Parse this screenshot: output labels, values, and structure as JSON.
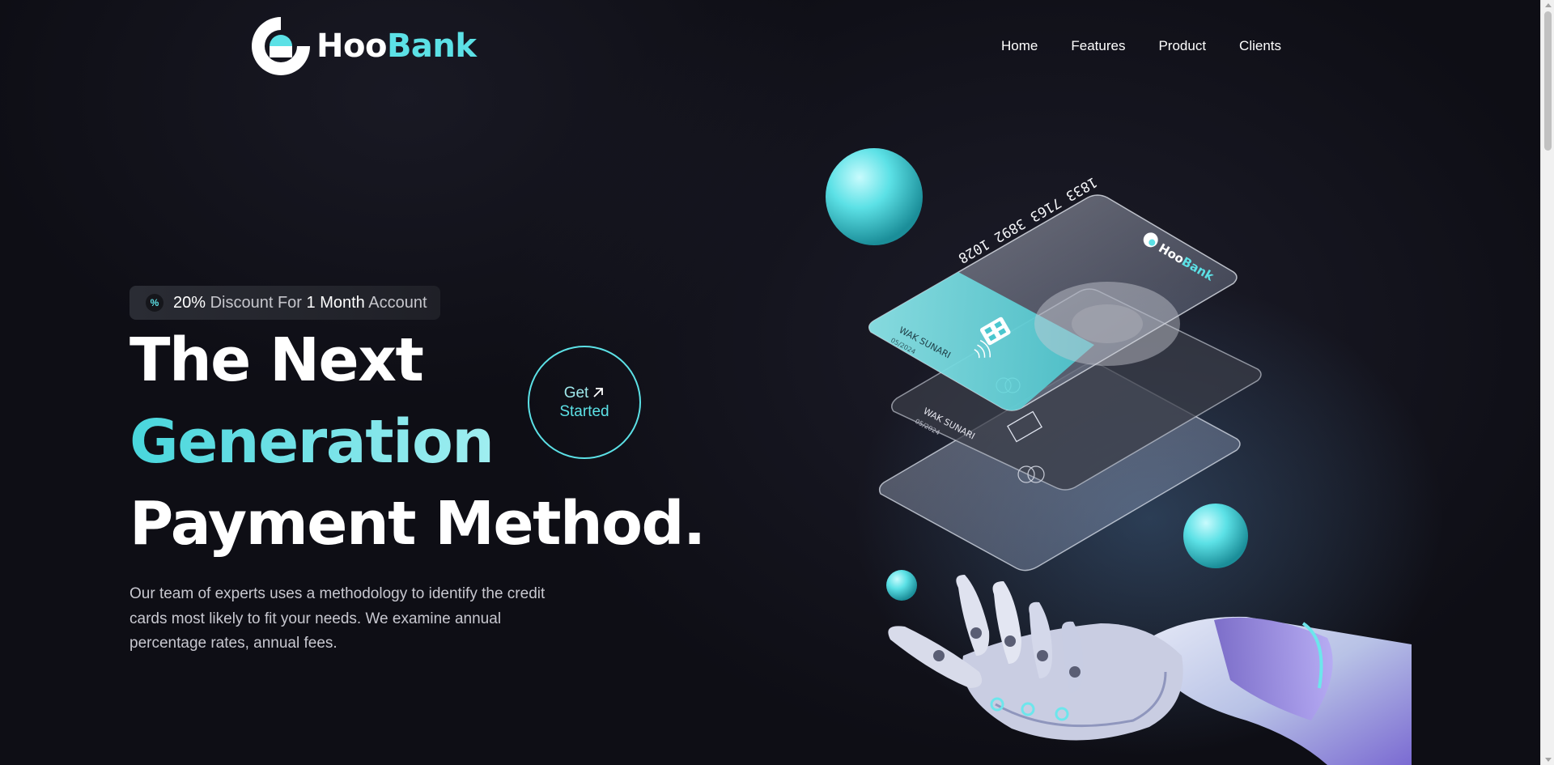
{
  "brand": {
    "name_part1": "Hoo",
    "name_part2": "Bank",
    "accent_color": "#5ce1e6"
  },
  "nav": {
    "items": [
      "Home",
      "Features",
      "Product",
      "Clients"
    ]
  },
  "badge": {
    "icon": "percent-icon",
    "value": "20%",
    "text1": "Discount For",
    "value2": "1 Month",
    "text2": "Account"
  },
  "hero": {
    "line1": "The Next",
    "line2": "Generation",
    "line3": "Payment Method.",
    "description": "Our team of experts uses a methodology to identify the credit cards most likely to fit your needs. We examine annual percentage rates, annual fees."
  },
  "cta": {
    "line1": "Get",
    "line2": "Started",
    "icon": "arrow-up-right-icon"
  },
  "card": {
    "number": "1833 7163 3892 1028",
    "holder": "WAK SUNARI",
    "expiry": "05/2024",
    "brand_hoo": "Hoo",
    "brand_bank": "Bank"
  }
}
